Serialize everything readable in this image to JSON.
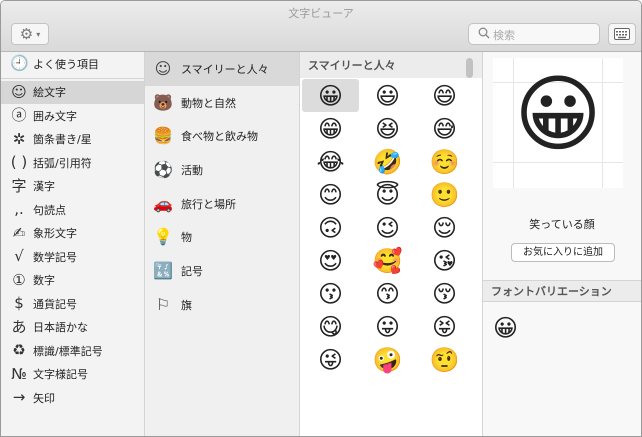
{
  "window": {
    "title": "文字ビューア"
  },
  "toolbar": {
    "search_placeholder": "検索"
  },
  "sidebar": {
    "items": [
      {
        "icon": "🕘",
        "label": "よく使う項目"
      },
      {
        "icon": "☺",
        "label": "絵文字"
      },
      {
        "icon": "ⓐ",
        "label": "囲み文字"
      },
      {
        "icon": "✲",
        "label": "箇条書き/星"
      },
      {
        "icon": "( )",
        "label": "括弧/引用符"
      },
      {
        "icon": "字",
        "label": "漢字"
      },
      {
        "icon": ",.",
        "label": "句読点"
      },
      {
        "icon": "✍",
        "label": "象形文字"
      },
      {
        "icon": "√",
        "label": "数学記号"
      },
      {
        "icon": "①",
        "label": "数字"
      },
      {
        "icon": "$",
        "label": "通貨記号"
      },
      {
        "icon": "あ",
        "label": "日本語かな"
      },
      {
        "icon": "♻",
        "label": "標識/標準記号"
      },
      {
        "icon": "№",
        "label": "文字様記号"
      },
      {
        "icon": "→",
        "label": "矢印"
      }
    ]
  },
  "categories": {
    "items": [
      {
        "icon": "☺",
        "label": "スマイリーと人々"
      },
      {
        "icon": "🐻",
        "label": "動物と自然"
      },
      {
        "icon": "🍔",
        "label": "食べ物と飲み物"
      },
      {
        "icon": "⚽",
        "label": "活動"
      },
      {
        "icon": "🚗",
        "label": "旅行と場所"
      },
      {
        "icon": "💡",
        "label": "物"
      },
      {
        "icon": "🔣",
        "label": "記号"
      },
      {
        "icon": "⚐",
        "label": "旗"
      }
    ]
  },
  "emoji_panel": {
    "header": "スマイリーと人々",
    "rows": [
      [
        "😀",
        "😃",
        "😄"
      ],
      [
        "😁",
        "😆",
        "😅"
      ],
      [
        "😂",
        "🤣",
        "☺️"
      ],
      [
        "😊",
        "😇",
        "🙂"
      ],
      [
        "🙃",
        "😉",
        "😌"
      ],
      [
        "😍",
        "🥰",
        "😘"
      ],
      [
        "😗",
        "😙",
        "😚"
      ],
      [
        "😋",
        "😛",
        "😝"
      ],
      [
        "😜",
        "🤪",
        "🤨"
      ]
    ]
  },
  "detail": {
    "emoji": "😀",
    "name": "笑っている顔",
    "favorite_button": "お気に入りに追加",
    "variation_header": "フォントバリエーション",
    "variants": [
      "😀"
    ]
  }
}
